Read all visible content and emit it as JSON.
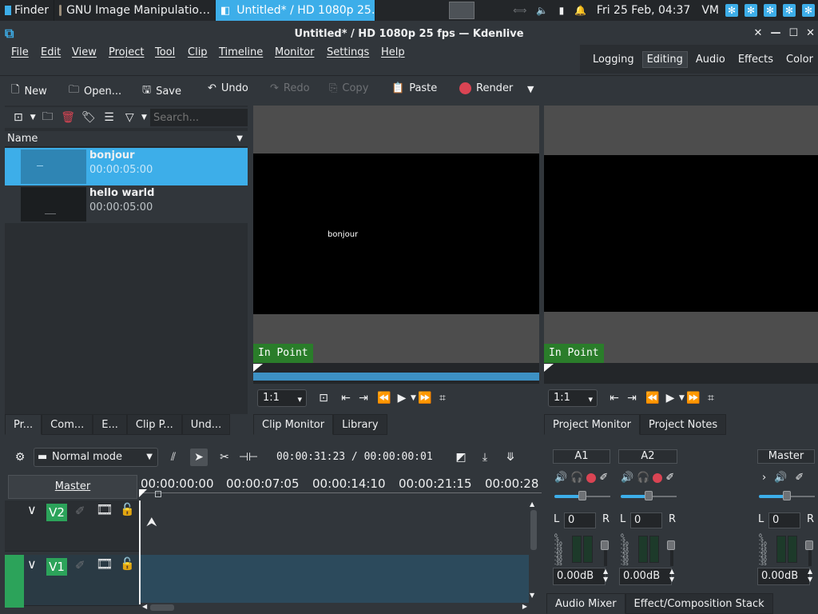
{
  "taskbar": {
    "tasks": [
      {
        "label": "Finder",
        "active": false
      },
      {
        "label": "GNU Image Manipulatio…",
        "active": false
      },
      {
        "label": "Untitled* / HD 1080p 25…",
        "active": true
      }
    ],
    "datetime": "Fri 25 Feb, 04:37",
    "vm_label": "VM"
  },
  "window": {
    "title": "Untitled* / HD 1080p 25 fps — Kdenlive"
  },
  "menu": [
    "File",
    "Edit",
    "View",
    "Project",
    "Tool",
    "Clip",
    "Timeline",
    "Monitor",
    "Settings",
    "Help"
  ],
  "layouts": {
    "items": [
      "Logging",
      "Editing",
      "Audio",
      "Effects",
      "Color"
    ],
    "active": "Editing"
  },
  "toolbar": {
    "new": "New",
    "open": "Open...",
    "save": "Save",
    "undo": "Undo",
    "redo": "Redo",
    "copy": "Copy",
    "paste": "Paste",
    "render": "Render"
  },
  "bin": {
    "search_placeholder": "Search...",
    "column_name": "Name",
    "clips": [
      {
        "name": "bonjour",
        "duration": "00:00:05:00",
        "selected": true
      },
      {
        "name": "hello warld",
        "duration": "00:00:05:00",
        "selected": false
      }
    ],
    "tabs": [
      "Pr...",
      "Com...",
      "E...",
      "Clip P...",
      "Und..."
    ]
  },
  "clip_monitor": {
    "overlay_text": "bonjour",
    "in_point": "In Point",
    "zoom": "1:1",
    "tabs": [
      "Clip Monitor",
      "Library"
    ]
  },
  "project_monitor": {
    "in_point": "In Point",
    "zoom": "1:1",
    "tabs": [
      "Project Monitor",
      "Project Notes"
    ]
  },
  "timeline": {
    "mode": "Normal mode",
    "timecode": "00:00:31:23 / 00:00:00:01",
    "master_label": "Master",
    "ruler": [
      "00:00:00:00",
      "00:00:07:05",
      "00:00:14:10",
      "00:00:21:15",
      "00:00:28"
    ],
    "tracks": [
      {
        "name": "V2"
      },
      {
        "name": "V1"
      }
    ]
  },
  "mixer": {
    "channels": [
      {
        "name": "A1",
        "gain": "0",
        "db": "0.00dB"
      },
      {
        "name": "A2",
        "gain": "0",
        "db": "0.00dB"
      },
      {
        "name": "Master",
        "gain": "0",
        "db": "0.00dB"
      }
    ],
    "left_label": "L",
    "right_label": "R",
    "meter_scale": [
      "0",
      "-5",
      "-10",
      "-15",
      "-20",
      "-25",
      "-30",
      "-35",
      "-40",
      "-45"
    ],
    "tabs": [
      "Audio Mixer",
      "Effect/Composition Stack"
    ]
  },
  "colors": {
    "accent": "#3daee9",
    "track_green": "#2ca35a",
    "in_point_green": "#2a7d2a",
    "bg": "#31363b"
  }
}
